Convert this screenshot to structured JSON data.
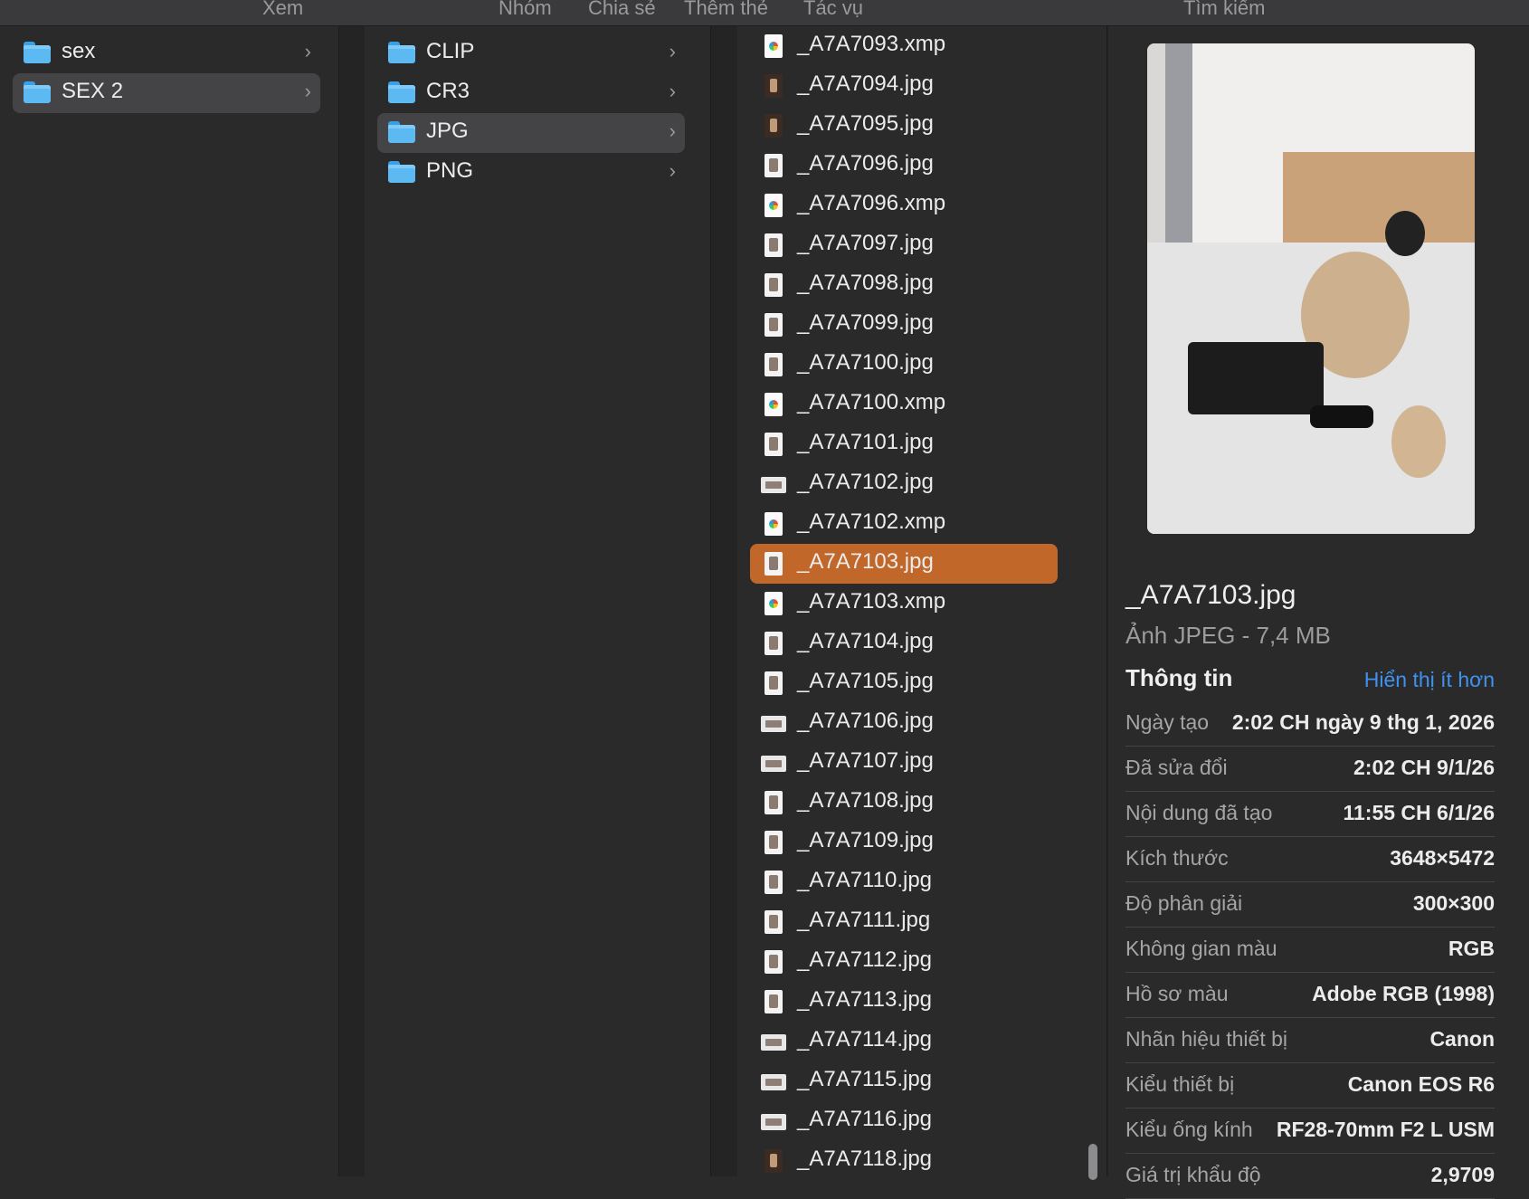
{
  "toolbar": {
    "view": "Xem",
    "group": "Nhóm",
    "share": "Chia sẻ",
    "tags": "Thêm thẻ",
    "actions": "Tác vụ",
    "search": "Tìm kiếm"
  },
  "column1": {
    "items": [
      {
        "label": "sex"
      },
      {
        "label": "SEX 2"
      }
    ]
  },
  "column2": {
    "items": [
      {
        "label": "CLIP"
      },
      {
        "label": "CR3"
      },
      {
        "label": "JPG"
      },
      {
        "label": "PNG"
      }
    ]
  },
  "column3": {
    "files": [
      "_A7A7093.xmp",
      "_A7A7094.jpg",
      "_A7A7095.jpg",
      "_A7A7096.jpg",
      "_A7A7096.xmp",
      "_A7A7097.jpg",
      "_A7A7098.jpg",
      "_A7A7099.jpg",
      "_A7A7100.jpg",
      "_A7A7100.xmp",
      "_A7A7101.jpg",
      "_A7A7102.jpg",
      "_A7A7102.xmp",
      "_A7A7103.jpg",
      "_A7A7103.xmp",
      "_A7A7104.jpg",
      "_A7A7105.jpg",
      "_A7A7106.jpg",
      "_A7A7107.jpg",
      "_A7A7108.jpg",
      "_A7A7109.jpg",
      "_A7A7110.jpg",
      "_A7A7111.jpg",
      "_A7A7112.jpg",
      "_A7A7113.jpg",
      "_A7A7114.jpg",
      "_A7A7115.jpg",
      "_A7A7116.jpg",
      "_A7A7118.jpg"
    ]
  },
  "preview": {
    "filename": "_A7A7103.jpg",
    "kind": "Ảnh JPEG - 7,4 MB",
    "info_heading": "Thông tin",
    "show_less": "Hiển thị ít hơn",
    "rows": [
      {
        "k": "Ngày tạo",
        "v": "2:02 CH ngày 9 thg 1, 2026"
      },
      {
        "k": "Đã sửa đổi",
        "v": "2:02 CH 9/1/26"
      },
      {
        "k": "Nội dung đã tạo",
        "v": "11:55 CH 6/1/26"
      },
      {
        "k": "Kích thước",
        "v": "3648×5472"
      },
      {
        "k": "Độ phân giải",
        "v": "300×300"
      },
      {
        "k": "Không gian màu",
        "v": "RGB"
      },
      {
        "k": "Hồ sơ màu",
        "v": "Adobe RGB (1998)"
      },
      {
        "k": "Nhãn hiệu thiết bị",
        "v": "Canon"
      },
      {
        "k": "Kiểu thiết bị",
        "v": "Canon EOS R6"
      },
      {
        "k": "Kiểu ống kính",
        "v": "RF28-70mm F2 L USM"
      },
      {
        "k": "Giá trị khẩu độ",
        "v": "2,9709"
      }
    ]
  },
  "colors": {
    "selection_active": "#c2672a",
    "selection_inactive": "#444345",
    "link": "#3f92f0",
    "folder": "#5cb9f2"
  }
}
